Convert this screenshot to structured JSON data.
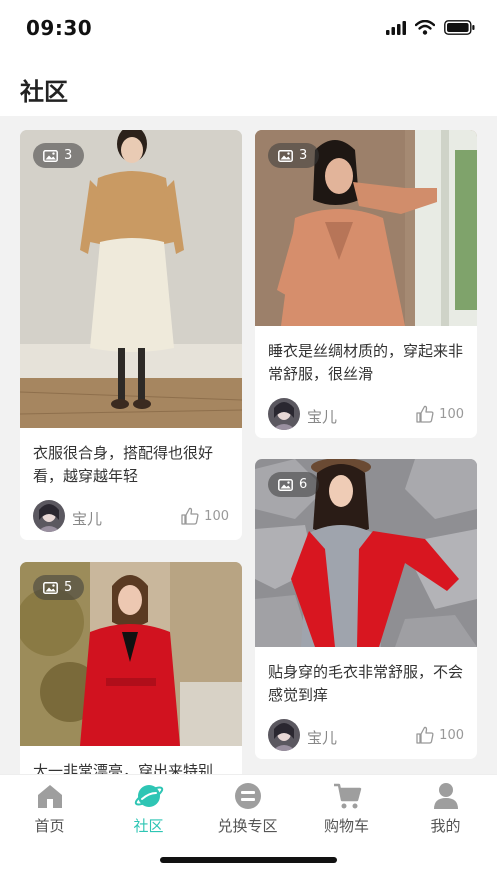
{
  "status_bar": {
    "time": "09:30"
  },
  "header": {
    "title": "社区"
  },
  "posts": [
    {
      "photo_count": "3",
      "description": "衣服很合身，搭配得也很好看，越穿越年轻",
      "author": "宝儿",
      "likes": "100"
    },
    {
      "photo_count": "3",
      "description": "睡衣是丝绸材质的，穿起来非常舒服，很丝滑",
      "author": "宝儿",
      "likes": "100"
    },
    {
      "photo_count": "5",
      "description": "大一非常漂亮，穿出来特别",
      "author": "",
      "likes": ""
    },
    {
      "photo_count": "6",
      "description": "贴身穿的毛衣非常舒服，不会感觉到痒",
      "author": "宝儿",
      "likes": "100"
    }
  ],
  "tabs": [
    {
      "label": "首页",
      "icon": "home-icon"
    },
    {
      "label": "社区",
      "icon": "planet-icon"
    },
    {
      "label": "兑换专区",
      "icon": "exchange-icon"
    },
    {
      "label": "购物车",
      "icon": "cart-icon"
    },
    {
      "label": "我的",
      "icon": "user-icon"
    }
  ],
  "colors": {
    "accent": "#2ec5b4",
    "background": "#f2f2f2",
    "card": "#ffffff"
  }
}
